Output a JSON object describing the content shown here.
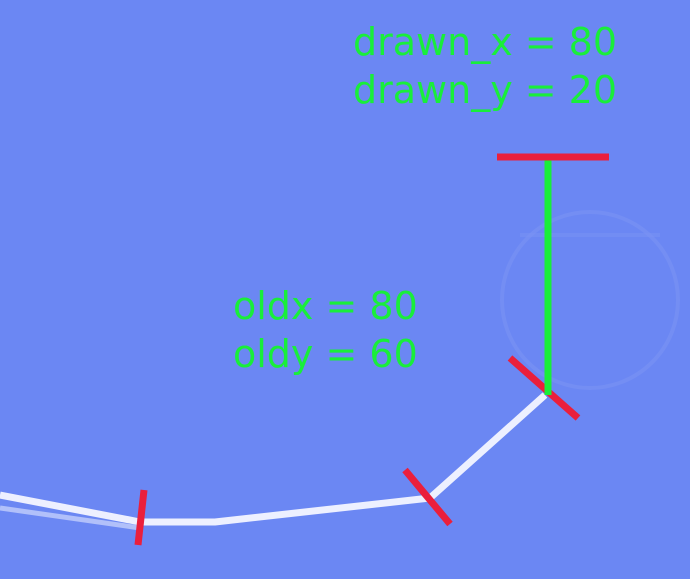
{
  "labels": {
    "drawn_x": "drawn_x = 80",
    "drawn_y": "drawn_y = 20",
    "old_x": "oldx = 80",
    "old_y": "oldy = 60"
  },
  "colors": {
    "background": "#6b87f3",
    "label_text": "#19ee3a",
    "path": "#f4f6ff",
    "marker": "#ea1f3c",
    "vertical_line": "#19ee3a",
    "faint_circle": "#7a93f4"
  }
}
